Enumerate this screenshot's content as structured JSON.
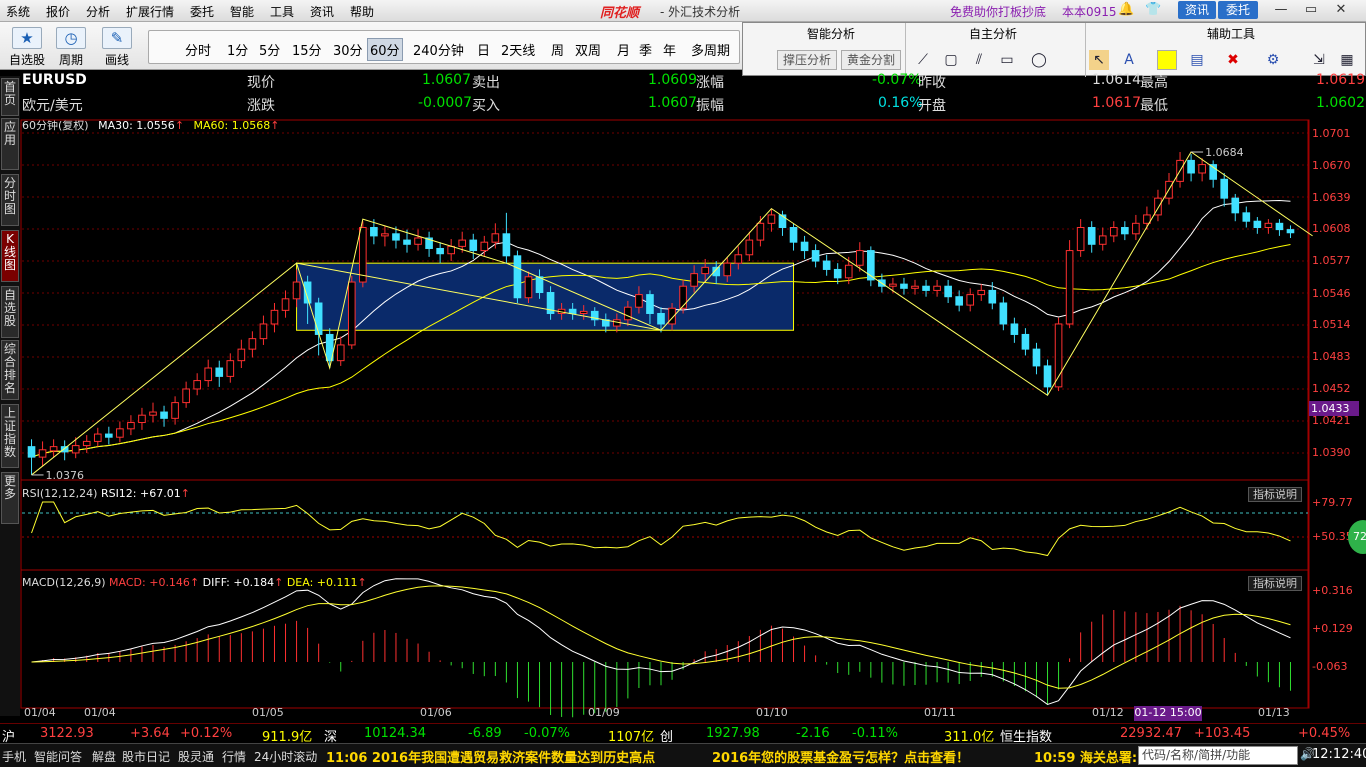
{
  "menu": {
    "items": [
      "系统",
      "报价",
      "分析",
      "扩展行情",
      "委托",
      "智能",
      "工具",
      "资讯",
      "帮助"
    ],
    "logo": "同花顺",
    "title": "- 外汇技术分析",
    "promo": "免费助你打板抄底",
    "version": "本本0915",
    "news": "资讯",
    "trade": "委托"
  },
  "toolbar": {
    "tools": [
      "自选股",
      "周期",
      "画线"
    ],
    "periods": [
      "分时",
      "1分",
      "5分",
      "15分",
      "30分",
      "60分",
      "240分钟",
      "日",
      "2天线",
      "周",
      "双周",
      "月",
      "季",
      "年",
      "多周期"
    ],
    "active_period": "60分"
  },
  "panel": {
    "sections": [
      "智能分析",
      "自主分析",
      "辅助工具"
    ],
    "buttons": [
      "撑压分析",
      "黄金分割"
    ]
  },
  "sidetabs": [
    "首页",
    "应用",
    "分时图",
    "K线图",
    "自选股",
    "综合排名",
    "上证指数",
    "更多"
  ],
  "quote": {
    "symbol": "EURUSD",
    "name": "欧元/美元",
    "l_now": "现价",
    "v_now": "1.0607",
    "l_sell": "卖出",
    "v_sell": "1.0609",
    "l_rise": "涨幅",
    "v_rise": "-0.07%",
    "l_prev": "昨收",
    "v_prev": "1.0614",
    "l_high": "最高",
    "v_high": "1.0619",
    "l_chg": "涨跌",
    "v_chg": "-0.0007",
    "l_buy": "买入",
    "v_buy": "1.0607",
    "l_amp": "振幅",
    "v_amp": "0.16%",
    "l_open": "开盘",
    "v_open": "1.0617",
    "l_low": "最低",
    "v_low": "1.0602"
  },
  "main_label": {
    "period": "60分钟(复权)",
    "ma30": "MA30: 1.0556",
    "ma60": "MA60: 1.0568"
  },
  "rsi_label": {
    "name": "RSI(12,12,24)",
    "val": "RSI12: +67.01"
  },
  "macd_label": {
    "name": "MACD(12,26,9)",
    "macd": "MACD: +0.146",
    "diff": "DIFF: +0.184",
    "dea": "DEA: +0.111"
  },
  "indicator_btn": "指标说明",
  "price_axis": [
    "1.0701",
    "1.0670",
    "1.0639",
    "1.0608",
    "1.0577",
    "1.0546",
    "1.0514",
    "1.0483",
    "1.0452",
    "1.0421",
    "1.0390"
  ],
  "rsi_axis": [
    "+79.77",
    "+50.35"
  ],
  "macd_axis": [
    "+0.316",
    "+0.129",
    "-0.063"
  ],
  "x_axis": [
    "01/04",
    "01/04",
    "01/05",
    "01/06",
    "01/09",
    "01/10",
    "01/11",
    "01/12",
    "01/13"
  ],
  "cursor_date": "01-12 15:00",
  "price_tag": "1.0433",
  "annotations": {
    "high": "1.0684",
    "low": "1.0376"
  },
  "green_circle": "72",
  "status": {
    "sh": "沪",
    "sh_v": "3122.93",
    "sh_c": "+3.64",
    "sh_p": "+0.12%",
    "sh_amt": "911.9亿",
    "sz": "深",
    "sz_v": "10124.34",
    "sz_c": "-6.89",
    "sz_p": "-0.07%",
    "sz_amt": "1107亿",
    "cy": "创",
    "cy_v": "1927.98",
    "cy_c": "-2.16",
    "cy_p": "-0.11%",
    "cy_amt": "311.0亿",
    "hs": "恒生指数",
    "hs_v": "22932.47",
    "hs_c": "+103.45",
    "hs_p": "+0.45%"
  },
  "bottom": {
    "items": [
      "手机",
      "智能问答",
      "解盘",
      "股市日记",
      "股灵通",
      "行情",
      "24小时滚动"
    ],
    "ticker1": "11:06 2016年我国遭遇贸易救济案件数量达到历史高点",
    "ticker2": "2016年您的股票基金盈亏怎样？点击查看！",
    "ticker3": "10:59 海关总署:",
    "search": "代码/名称/简拼/功能",
    "clock": "12:12:40"
  },
  "chart_data": {
    "type": "candlestick",
    "ylim": [
      1.0375,
      1.0705
    ],
    "candles": [
      [
        1.0403,
        1.0393,
        1.041,
        1.0376
      ],
      [
        1.0393,
        1.04,
        1.0408,
        1.0384
      ],
      [
        1.0399,
        1.0403,
        1.041,
        1.0393
      ],
      [
        1.0403,
        1.0398,
        1.0409,
        1.039
      ],
      [
        1.0397,
        1.0404,
        1.0412,
        1.0392
      ],
      [
        1.0404,
        1.0408,
        1.0414,
        1.0397
      ],
      [
        1.0408,
        1.0415,
        1.0421,
        1.0403
      ],
      [
        1.0415,
        1.0412,
        1.0422,
        1.0405
      ],
      [
        1.0412,
        1.042,
        1.0427,
        1.0407
      ],
      [
        1.042,
        1.0426,
        1.0433,
        1.0414
      ],
      [
        1.0426,
        1.0433,
        1.044,
        1.0419
      ],
      [
        1.0433,
        1.0436,
        1.0445,
        1.0426
      ],
      [
        1.0436,
        1.043,
        1.0442,
        1.0422
      ],
      [
        1.043,
        1.0445,
        1.0451,
        1.0424
      ],
      [
        1.0445,
        1.0458,
        1.0465,
        1.044
      ],
      [
        1.0458,
        1.0466,
        1.0473,
        1.0452
      ],
      [
        1.0466,
        1.0478,
        1.0486,
        1.046
      ],
      [
        1.0478,
        1.047,
        1.0485,
        1.046
      ],
      [
        1.047,
        1.0485,
        1.0492,
        1.0464
      ],
      [
        1.0485,
        1.0496,
        1.0505,
        1.0478
      ],
      [
        1.0496,
        1.0506,
        1.0513,
        1.0488
      ],
      [
        1.0506,
        1.052,
        1.0528,
        1.05
      ],
      [
        1.052,
        1.0533,
        1.054,
        1.0512
      ],
      [
        1.0533,
        1.0544,
        1.0552,
        1.0526
      ],
      [
        1.0544,
        1.056,
        1.0572,
        1.0536
      ],
      [
        1.056,
        1.054,
        1.0566,
        1.052
      ],
      [
        1.054,
        1.051,
        1.0545,
        1.049
      ],
      [
        1.051,
        1.0485,
        1.0516,
        1.0478
      ],
      [
        1.0485,
        1.05,
        1.0508,
        1.048
      ],
      [
        1.05,
        1.056,
        1.0566,
        1.0496
      ],
      [
        1.056,
        1.0612,
        1.0618,
        1.0555
      ],
      [
        1.0612,
        1.0604,
        1.062,
        1.0596
      ],
      [
        1.0604,
        1.0606,
        1.0614,
        1.0594
      ],
      [
        1.0606,
        1.06,
        1.0613,
        1.0592
      ],
      [
        1.06,
        1.0596,
        1.061,
        1.0588
      ],
      [
        1.0596,
        1.0602,
        1.061,
        1.059
      ],
      [
        1.0602,
        1.0592,
        1.0608,
        1.0584
      ],
      [
        1.0592,
        1.0587,
        1.0598,
        1.0578
      ],
      [
        1.0587,
        1.0594,
        1.0601,
        1.058
      ],
      [
        1.0594,
        1.06,
        1.0608,
        1.0588
      ],
      [
        1.06,
        1.059,
        1.0606,
        1.0582
      ],
      [
        1.059,
        1.0598,
        1.0604,
        1.0584
      ],
      [
        1.0598,
        1.0606,
        1.0616,
        1.0592
      ],
      [
        1.0606,
        1.0585,
        1.0626,
        1.0578
      ],
      [
        1.0585,
        1.0545,
        1.059,
        1.054
      ],
      [
        1.0545,
        1.0565,
        1.057,
        1.054
      ],
      [
        1.0565,
        1.055,
        1.0572,
        1.0544
      ],
      [
        1.055,
        1.053,
        1.0556,
        1.0524
      ],
      [
        1.053,
        1.0534,
        1.054,
        1.0524
      ],
      [
        1.0534,
        1.053,
        1.054,
        1.0524
      ],
      [
        1.053,
        1.0532,
        1.0538,
        1.0524
      ],
      [
        1.0532,
        1.0524,
        1.0536,
        1.0518
      ],
      [
        1.0524,
        1.0518,
        1.053,
        1.0512
      ],
      [
        1.0518,
        1.0524,
        1.053,
        1.0512
      ],
      [
        1.0524,
        1.0536,
        1.0542,
        1.0518
      ],
      [
        1.0536,
        1.0548,
        1.0556,
        1.053
      ],
      [
        1.0548,
        1.053,
        1.0552,
        1.052
      ],
      [
        1.053,
        1.052,
        1.0536,
        1.0512
      ],
      [
        1.052,
        1.0535,
        1.054,
        1.0514
      ],
      [
        1.0535,
        1.0556,
        1.0562,
        1.053
      ],
      [
        1.0556,
        1.0568,
        1.0576,
        1.055
      ],
      [
        1.0568,
        1.0574,
        1.0582,
        1.056
      ],
      [
        1.0574,
        1.0566,
        1.058,
        1.0558
      ],
      [
        1.0566,
        1.0578,
        1.0584,
        1.056
      ],
      [
        1.0578,
        1.0586,
        1.0594,
        1.0572
      ],
      [
        1.0586,
        1.06,
        1.0608,
        1.058
      ],
      [
        1.06,
        1.0616,
        1.0623,
        1.0594
      ],
      [
        1.0616,
        1.0624,
        1.063,
        1.0608
      ],
      [
        1.0624,
        1.0612,
        1.0628,
        1.0604
      ],
      [
        1.0612,
        1.0598,
        1.0616,
        1.059
      ],
      [
        1.0598,
        1.059,
        1.0604,
        1.0582
      ],
      [
        1.059,
        1.058,
        1.0596,
        1.0574
      ],
      [
        1.058,
        1.0572,
        1.0586,
        1.0566
      ],
      [
        1.0572,
        1.0564,
        1.0578,
        1.0558
      ],
      [
        1.0564,
        1.0576,
        1.0584,
        1.0558
      ],
      [
        1.0576,
        1.059,
        1.0598,
        1.057
      ],
      [
        1.059,
        1.0562,
        1.0594,
        1.0556
      ],
      [
        1.0562,
        1.0556,
        1.0568,
        1.055
      ],
      [
        1.0556,
        1.0558,
        1.0564,
        1.055
      ],
      [
        1.0558,
        1.0554,
        1.0564,
        1.0548
      ],
      [
        1.0554,
        1.0556,
        1.0562,
        1.0548
      ],
      [
        1.0556,
        1.0552,
        1.0562,
        1.0546
      ],
      [
        1.0552,
        1.0556,
        1.0562,
        1.0546
      ],
      [
        1.0556,
        1.0546,
        1.0562,
        1.054
      ],
      [
        1.0546,
        1.0538,
        1.0552,
        1.0532
      ],
      [
        1.0538,
        1.0548,
        1.0554,
        1.0532
      ],
      [
        1.0548,
        1.0552,
        1.0558,
        1.0542
      ],
      [
        1.0552,
        1.054,
        1.056,
        1.0534
      ],
      [
        1.054,
        1.052,
        1.0546,
        1.0514
      ],
      [
        1.052,
        1.051,
        1.0526,
        1.0502
      ],
      [
        1.051,
        1.0496,
        1.0516,
        1.049
      ],
      [
        1.0496,
        1.048,
        1.0502,
        1.0472
      ],
      [
        1.048,
        1.046,
        1.0486,
        1.0452
      ],
      [
        1.046,
        1.052,
        1.0526,
        1.0456
      ],
      [
        1.052,
        1.059,
        1.06,
        1.0516
      ],
      [
        1.059,
        1.0612,
        1.062,
        1.0584
      ],
      [
        1.0612,
        1.0596,
        1.0618,
        1.0588
      ],
      [
        1.0596,
        1.0604,
        1.0612,
        1.059
      ],
      [
        1.0604,
        1.0612,
        1.0618,
        1.0598
      ],
      [
        1.0612,
        1.0606,
        1.0618,
        1.06
      ],
      [
        1.0606,
        1.0616,
        1.0624,
        1.06
      ],
      [
        1.0616,
        1.0624,
        1.0632,
        1.061
      ],
      [
        1.0624,
        1.064,
        1.0648,
        1.0618
      ],
      [
        1.064,
        1.0656,
        1.0664,
        1.0634
      ],
      [
        1.0656,
        1.0676,
        1.0684,
        1.065
      ],
      [
        1.0676,
        1.0664,
        1.0682,
        1.0656
      ],
      [
        1.0664,
        1.0672,
        1.0678,
        1.0656
      ],
      [
        1.0672,
        1.0658,
        1.0676,
        1.065
      ],
      [
        1.0658,
        1.064,
        1.0664,
        1.0632
      ],
      [
        1.064,
        1.0626,
        1.0644,
        1.0618
      ],
      [
        1.0626,
        1.0618,
        1.0632,
        1.0612
      ],
      [
        1.0618,
        1.0612,
        1.0622,
        1.0606
      ],
      [
        1.0612,
        1.0616,
        1.062,
        1.0606
      ],
      [
        1.0616,
        1.061,
        1.062,
        1.0604
      ],
      [
        1.061,
        1.0607,
        1.0614,
        1.0602
      ]
    ]
  }
}
